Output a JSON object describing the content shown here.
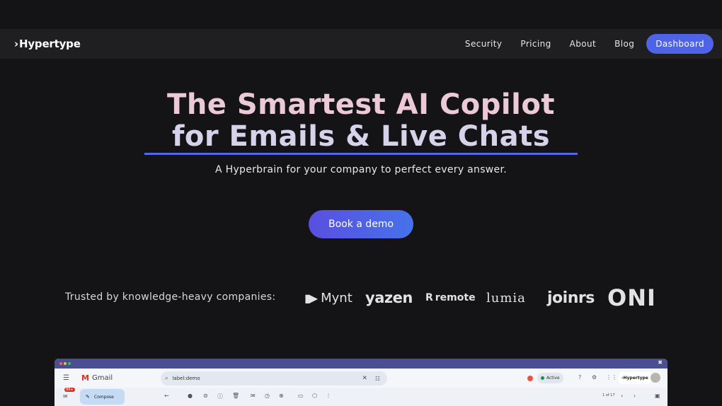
{
  "nav": {
    "logo_mark": "›",
    "logo_text": "Hypertype",
    "links": [
      "Security",
      "Pricing",
      "About",
      "Blog"
    ],
    "cta": "Dashboard"
  },
  "hero": {
    "title_line1": "The Smartest AI Copilot",
    "title_line2": "for Emails & Live Chats",
    "subtitle": "A Hyperbrain for your company to perfect every answer.",
    "cta": "Book a demo"
  },
  "trusted": {
    "label": "Trusted by knowledge-heavy companies:",
    "brands": [
      "Mynt",
      "yazen",
      "remote",
      "lumia",
      "joinrs",
      "ONI"
    ]
  },
  "colors": {
    "background": "#141416",
    "nav": "#1f1f21",
    "accent": "#4f63e6",
    "title_pink": "#ecc9d6",
    "underline": "#5566ef"
  },
  "app_preview": {
    "app_name": "Gmail",
    "search_query": "label:demo",
    "status": "Active",
    "chip": "›Hypertype",
    "compose": "Compose",
    "badge": "99+",
    "pager": "1 of 17"
  }
}
